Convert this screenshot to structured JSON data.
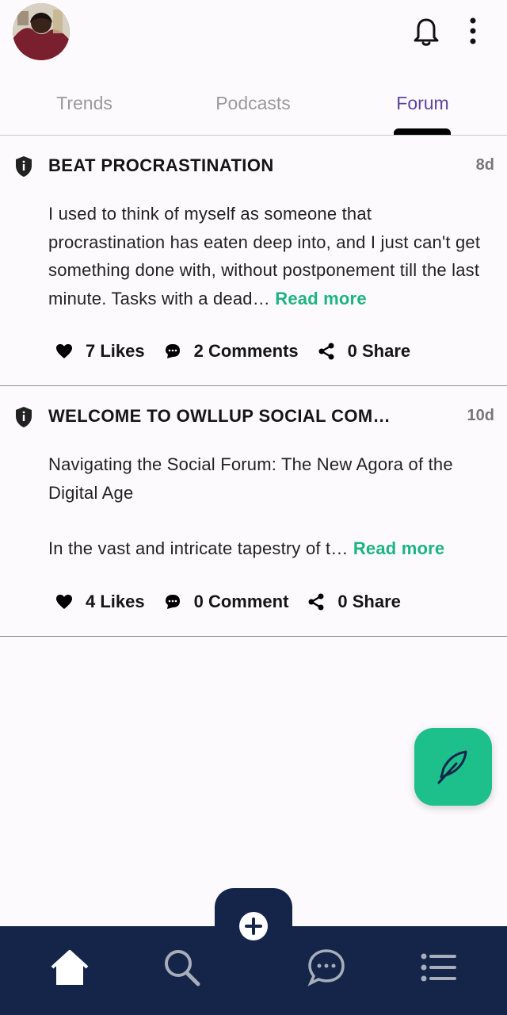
{
  "header": {
    "avatar_icon": "user-avatar",
    "notifications_icon": "bell-icon",
    "menu_icon": "more-vertical-icon"
  },
  "tabs": [
    {
      "label": "Trends"
    },
    {
      "label": "Podcasts"
    },
    {
      "label": "Forum",
      "active": true
    }
  ],
  "posts": [
    {
      "title": "BEAT PROCRASTINATION",
      "age": "8d",
      "excerpt": "I used to think of myself as someone that procrastination has eaten deep into, and I just can't get something done with, without postponement till the last minute. Tasks with a dead…",
      "read_more": "Read more",
      "likes": "7 Likes",
      "comments": "2 Comments",
      "shares": "0 Share"
    },
    {
      "title": "WELCOME TO OWLLUP SOCIAL COM…",
      "age": "10d",
      "excerpt_line1": "Navigating the Social Forum: The New Agora of the Digital Age",
      "excerpt_line2": "In the vast and intricate tapestry of t…",
      "read_more": "Read more",
      "likes": "4 Likes",
      "comments": "0 Comment",
      "shares": "0 Share"
    }
  ],
  "colors": {
    "accent": "#1dbf8b",
    "active_tab": "#5d449a",
    "nav_background": "#15254a"
  },
  "bottom_nav": {
    "items": [
      "home-icon",
      "search-icon",
      "chat-icon",
      "list-icon"
    ],
    "center_action": "plus-icon"
  }
}
